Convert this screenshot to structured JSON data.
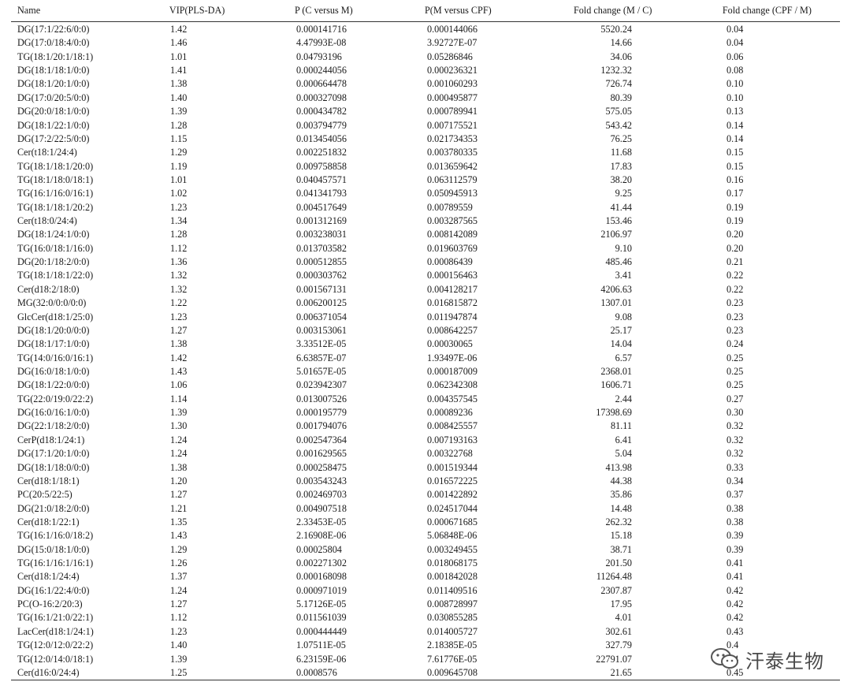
{
  "table": {
    "headers": [
      "Name",
      "VIP(PLS-DA)",
      "P (C versus M)",
      "P(M versus CPF)",
      "Fold change (M / C)",
      "Fold change (CPF / M)"
    ],
    "rows": [
      [
        "DG(17:1/22:6/0:0)",
        "1.42",
        "0.000141716",
        "0.000144066",
        "5520.24",
        "0.04"
      ],
      [
        "DG(17:0/18:4/0:0)",
        "1.46",
        "4.47993E-08",
        "3.92727E-07",
        "14.66",
        "0.04"
      ],
      [
        "TG(18:1/20:1/18:1)",
        "1.01",
        "0.04793196",
        "0.05286846",
        "34.06",
        "0.06"
      ],
      [
        "DG(18:1/18:1/0:0)",
        "1.41",
        "0.000244056",
        "0.000236321",
        "1232.32",
        "0.08"
      ],
      [
        "DG(18:1/20:1/0:0)",
        "1.38",
        "0.000664478",
        "0.001060293",
        "726.74",
        "0.10"
      ],
      [
        "DG(17:0/20:5/0:0)",
        "1.40",
        "0.000327098",
        "0.000495877",
        "80.39",
        "0.10"
      ],
      [
        "DG(20:0/18:1/0:0)",
        "1.39",
        "0.000434782",
        "0.000789941",
        "575.05",
        "0.13"
      ],
      [
        "DG(18:1/22:1/0:0)",
        "1.28",
        "0.003794779",
        "0.007175521",
        "543.42",
        "0.14"
      ],
      [
        "DG(17:2/22:5/0:0)",
        "1.15",
        "0.013454056",
        "0.021734353",
        "76.25",
        "0.14"
      ],
      [
        "Cer(t18:1/24:4)",
        "1.29",
        "0.002251832",
        "0.003780335",
        "11.68",
        "0.15"
      ],
      [
        "TG(18:1/18:1/20:0)",
        "1.19",
        "0.009758858",
        "0.013659642",
        "17.83",
        "0.15"
      ],
      [
        "TG(18:1/18:0/18:1)",
        "1.01",
        "0.040457571",
        "0.063112579",
        "38.20",
        "0.16"
      ],
      [
        "TG(16:1/16:0/16:1)",
        "1.02",
        "0.041341793",
        "0.050945913",
        "9.25",
        "0.17"
      ],
      [
        "TG(18:1/18:1/20:2)",
        "1.23",
        "0.004517649",
        "0.00789559",
        "41.44",
        "0.19"
      ],
      [
        "Cer(t18:0/24:4)",
        "1.34",
        "0.001312169",
        "0.003287565",
        "153.46",
        "0.19"
      ],
      [
        "DG(18:1/24:1/0:0)",
        "1.28",
        "0.003238031",
        "0.008142089",
        "2106.97",
        "0.20"
      ],
      [
        "TG(16:0/18:1/16:0)",
        "1.12",
        "0.013703582",
        "0.019603769",
        "9.10",
        "0.20"
      ],
      [
        "DG(20:1/18:2/0:0)",
        "1.36",
        "0.000512855",
        "0.00086439",
        "485.46",
        "0.21"
      ],
      [
        "TG(18:1/18:1/22:0)",
        "1.32",
        "0.000303762",
        "0.000156463",
        "3.41",
        "0.22"
      ],
      [
        "Cer(d18:2/18:0)",
        "1.32",
        "0.001567131",
        "0.004128217",
        "4206.63",
        "0.22"
      ],
      [
        "MG(32:0/0:0/0:0)",
        "1.22",
        "0.006200125",
        "0.016815872",
        "1307.01",
        "0.23"
      ],
      [
        "GlcCer(d18:1/25:0)",
        "1.23",
        "0.006371054",
        "0.011947874",
        "9.08",
        "0.23"
      ],
      [
        "DG(18:1/20:0/0:0)",
        "1.27",
        "0.003153061",
        "0.008642257",
        "25.17",
        "0.23"
      ],
      [
        "DG(18:1/17:1/0:0)",
        "1.38",
        "3.33512E-05",
        "0.00030065",
        "14.04",
        "0.24"
      ],
      [
        "TG(14:0/16:0/16:1)",
        "1.42",
        "6.63857E-07",
        "1.93497E-06",
        "6.57",
        "0.25"
      ],
      [
        "DG(16:0/18:1/0:0)",
        "1.43",
        "5.01657E-05",
        "0.000187009",
        "2368.01",
        "0.25"
      ],
      [
        "DG(18:1/22:0/0:0)",
        "1.06",
        "0.023942307",
        "0.062342308",
        "1606.71",
        "0.25"
      ],
      [
        "TG(22:0/19:0/22:2)",
        "1.14",
        "0.013007526",
        "0.004357545",
        "2.44",
        "0.27"
      ],
      [
        "DG(16:0/16:1/0:0)",
        "1.39",
        "0.000195779",
        "0.00089236",
        "17398.69",
        "0.30"
      ],
      [
        "DG(22:1/18:2/0:0)",
        "1.30",
        "0.001794076",
        "0.008425557",
        "81.11",
        "0.32"
      ],
      [
        "CerP(d18:1/24:1)",
        "1.24",
        "0.002547364",
        "0.007193163",
        "6.41",
        "0.32"
      ],
      [
        "DG(17:1/20:1/0:0)",
        "1.24",
        "0.001629565",
        "0.00322768",
        "5.04",
        "0.32"
      ],
      [
        "DG(18:1/18:0/0:0)",
        "1.38",
        "0.000258475",
        "0.001519344",
        "413.98",
        "0.33"
      ],
      [
        "Cer(d18:1/18:1)",
        "1.20",
        "0.003543243",
        "0.016572225",
        "44.38",
        "0.34"
      ],
      [
        "PC(20:5/22:5)",
        "1.27",
        "0.002469703",
        "0.001422892",
        "35.86",
        "0.37"
      ],
      [
        "DG(21:0/18:2/0:0)",
        "1.21",
        "0.004907518",
        "0.024517044",
        "14.48",
        "0.38"
      ],
      [
        "Cer(d18:1/22:1)",
        "1.35",
        "2.33453E-05",
        "0.000671685",
        "262.32",
        "0.38"
      ],
      [
        "TG(16:1/16:0/18:2)",
        "1.43",
        "2.16908E-06",
        "5.06848E-06",
        "15.18",
        "0.39"
      ],
      [
        "DG(15:0/18:1/0:0)",
        "1.29",
        "0.00025804",
        "0.003249455",
        "38.71",
        "0.39"
      ],
      [
        "TG(16:1/16:1/16:1)",
        "1.26",
        "0.002271302",
        "0.018068175",
        "201.50",
        "0.41"
      ],
      [
        "Cer(d18:1/24:4)",
        "1.37",
        "0.000168098",
        "0.001842028",
        "11264.48",
        "0.41"
      ],
      [
        "DG(16:1/22:4/0:0)",
        "1.24",
        "0.000971019",
        "0.011409516",
        "2307.87",
        "0.42"
      ],
      [
        "PC(O-16:2/20:3)",
        "1.27",
        "5.17126E-05",
        "0.008728997",
        "17.95",
        "0.42"
      ],
      [
        "TG(16:1/21:0/22:1)",
        "1.12",
        "0.011561039",
        "0.030855285",
        "4.01",
        "0.42"
      ],
      [
        "LacCer(d18:1/24:1)",
        "1.23",
        "0.000444449",
        "0.014005727",
        "302.61",
        "0.43"
      ],
      [
        "TG(12:0/12:0/22:2)",
        "1.40",
        "1.07511E-05",
        "2.18385E-05",
        "327.79",
        "0.4"
      ],
      [
        "TG(12:0/14:0/18:1)",
        "1.39",
        "6.23159E-06",
        "7.61776E-05",
        "22791.07",
        "0.4"
      ],
      [
        "Cer(d16:0/24:4)",
        "1.25",
        "0.0008576",
        "0.009645708",
        "21.65",
        "0.45"
      ]
    ]
  },
  "watermark": {
    "text": "汗泰生物",
    "icon": "wechat-icon"
  }
}
